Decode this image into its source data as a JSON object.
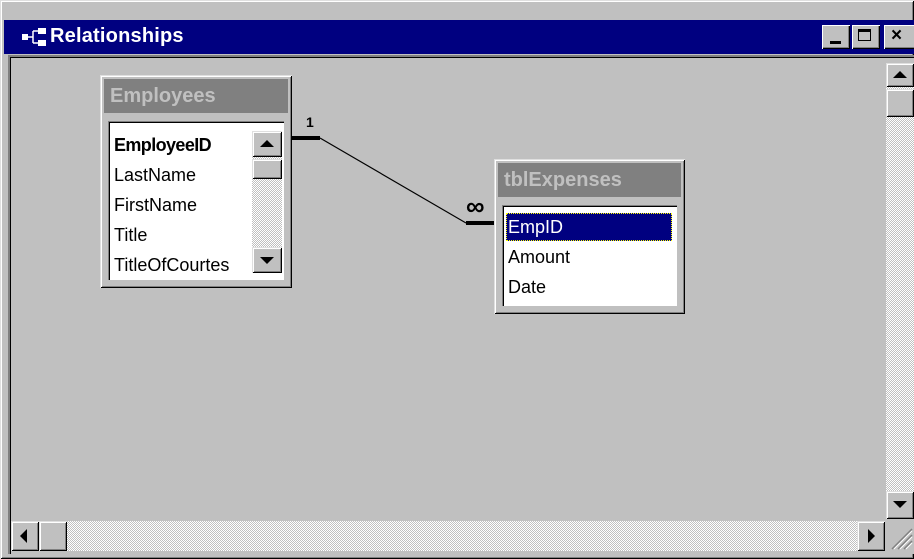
{
  "window": {
    "title": "Relationships",
    "icon": "relationships-icon",
    "controls": {
      "minimize": "minimize-icon",
      "maximize": "maximize-icon",
      "close": "×"
    }
  },
  "tables": [
    {
      "name": "Employees",
      "fields": [
        {
          "label": "EmployeeID",
          "primary_key": true
        },
        {
          "label": "LastName"
        },
        {
          "label": "FirstName"
        },
        {
          "label": "Title"
        },
        {
          "label": "TitleOfCourtes"
        }
      ]
    },
    {
      "name": "tblExpenses",
      "fields": [
        {
          "label": "EmpID",
          "selected": true
        },
        {
          "label": "Amount"
        },
        {
          "label": "Date"
        }
      ]
    }
  ],
  "relationship": {
    "from_table": "Employees",
    "from_field": "EmployeeID",
    "to_table": "tblExpenses",
    "to_field": "EmpID",
    "one_label": "1",
    "many_label": "∞"
  },
  "colors": {
    "titlebar": "#000080",
    "selection": "#000080",
    "inactive_table_title": "#808080",
    "face": "#c0c0c0"
  }
}
